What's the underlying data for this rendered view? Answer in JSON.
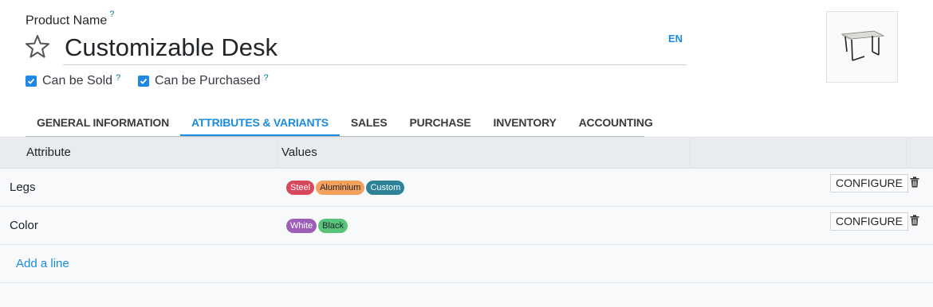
{
  "form": {
    "product_name_label": "Product Name",
    "help_mark": "?",
    "name_value": "Customizable Desk",
    "lang": "EN",
    "can_be_sold_label": "Can be Sold",
    "can_be_purchased_label": "Can be Purchased",
    "can_be_sold": true,
    "can_be_purchased": true
  },
  "tabs": [
    {
      "label": "GENERAL INFORMATION",
      "active": false
    },
    {
      "label": "ATTRIBUTES & VARIANTS",
      "active": true
    },
    {
      "label": "SALES",
      "active": false
    },
    {
      "label": "PURCHASE",
      "active": false
    },
    {
      "label": "INVENTORY",
      "active": false
    },
    {
      "label": "ACCOUNTING",
      "active": false
    }
  ],
  "table": {
    "headers": {
      "attribute": "Attribute",
      "values": "Values"
    },
    "rows": [
      {
        "attribute": "Legs",
        "values": [
          {
            "label": "Steel",
            "color": "#d8475b"
          },
          {
            "label": "Aluminium",
            "color": "#f3a15c"
          },
          {
            "label": "Custom",
            "color": "#2c8397"
          }
        ],
        "configure_label": "CONFIGURE"
      },
      {
        "attribute": "Color",
        "values": [
          {
            "label": "White",
            "color": "#9e5db7"
          },
          {
            "label": "Black",
            "color": "#58c47a"
          }
        ],
        "configure_label": "CONFIGURE"
      }
    ],
    "add_line": "Add a line"
  },
  "colors": {
    "accent": "#1a8be0",
    "checkbox": "#1f87e5"
  }
}
